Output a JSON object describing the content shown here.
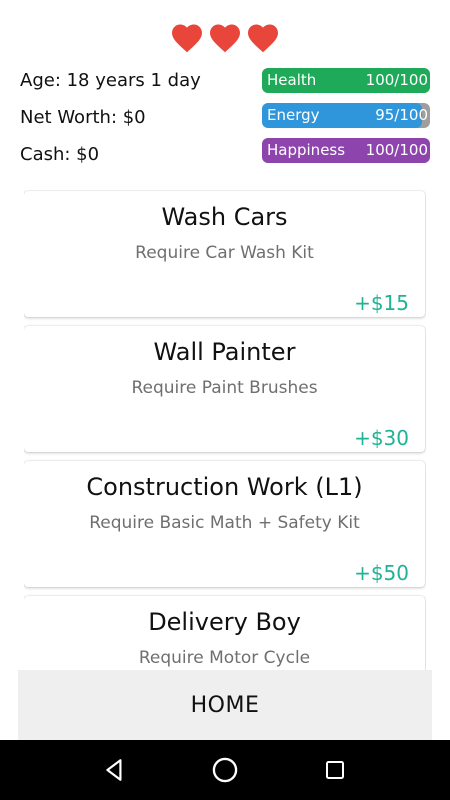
{
  "hearts": {
    "count": 3,
    "color": "#e8463b"
  },
  "stats": {
    "age": "Age: 18 years 1 day",
    "net_worth": "Net Worth: $0",
    "cash": "Cash: $0"
  },
  "bars": [
    {
      "label": "Health",
      "value": "100/100",
      "level": 1.0,
      "color": "#1faa5a"
    },
    {
      "label": "Energy",
      "value": "95/100",
      "level": 0.95,
      "color": "#2f96dc"
    },
    {
      "label": "Happiness",
      "value": "100/100",
      "level": 1.0,
      "color": "#8e44ad"
    }
  ],
  "jobs": [
    {
      "title": "Wash Cars",
      "requirement": "Require Car Wash Kit",
      "pay": "+$15"
    },
    {
      "title": "Wall Painter",
      "requirement": "Require Paint Brushes",
      "pay": "+$30"
    },
    {
      "title": "Construction Work (L1)",
      "requirement": "Require Basic Math + Safety Kit",
      "pay": "+$50"
    },
    {
      "title": "Delivery Boy",
      "requirement": "Require Motor Cycle",
      "pay": ""
    }
  ],
  "home": {
    "label": "HOME"
  },
  "nav": {
    "back_icon": "back-icon",
    "home_icon": "home-circle-icon",
    "recents_icon": "recents-icon"
  }
}
